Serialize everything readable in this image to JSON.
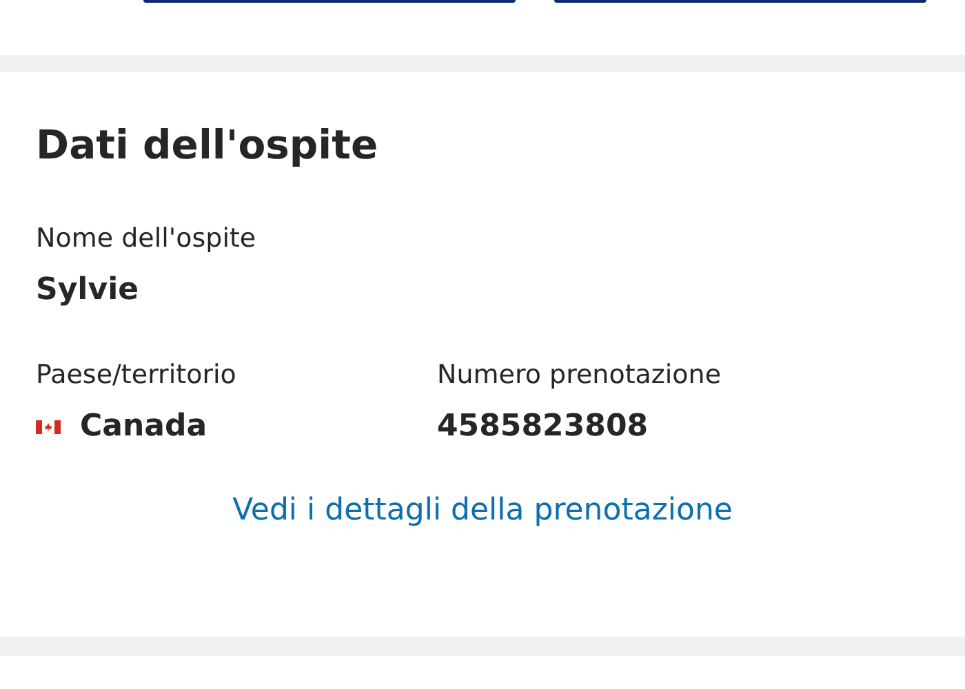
{
  "guest_details": {
    "title": "Dati dell'ospite",
    "fields": [
      {
        "label": "Nome dell'ospite",
        "value": "Sylvie"
      }
    ],
    "fields_row": [
      {
        "kind": "flag",
        "label": "Paese/territorio",
        "value": "Canada"
      },
      {
        "kind": "text",
        "label": "Numero prenotazione",
        "value": "4585823808"
      }
    ],
    "link": "Vedi i dettagli della prenotazione"
  }
}
